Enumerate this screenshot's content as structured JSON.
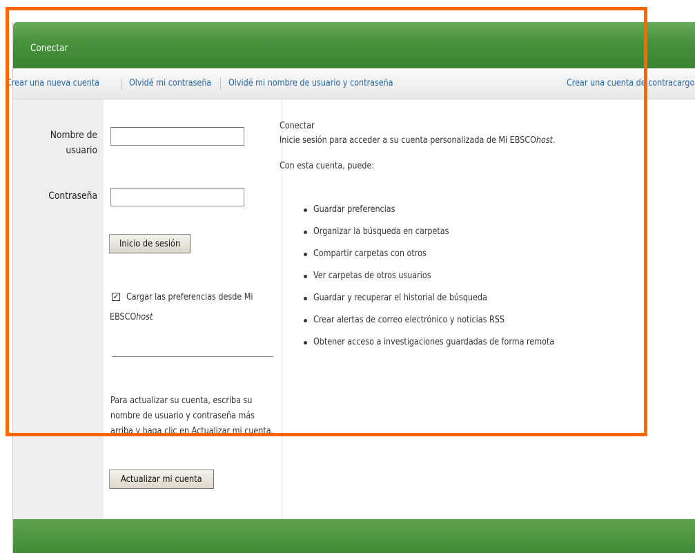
{
  "header": {
    "title": "Conectar"
  },
  "nav": {
    "links": [
      "Crear una nueva cuenta",
      "Olvidé mi contraseña",
      "Olvidé mi nombre de usuario y contraseña",
      "Crear una cuenta de contracargo"
    ]
  },
  "login": {
    "username_label_line1": "Nombre de",
    "username_label_line2": "usuario",
    "username_value": "",
    "password_label": "Contraseña",
    "password_value": "",
    "signin_button": "Inicio de sesión",
    "checkbox_checked": true,
    "checkbox_label_line1": "Cargar las preferencias desde Mi",
    "checkbox_label_line2_prefix": "EBSCO",
    "checkbox_label_line2_italic": "host"
  },
  "update": {
    "text_line1": "Para actualizar su cuenta, escriba su",
    "text_line2": "nombre de usuario y contraseña más",
    "text_line3": "arriba y haga clic en Actualizar mi cuenta.",
    "button": "Actualizar mi cuenta"
  },
  "info": {
    "heading": "Conectar",
    "intro_prefix": "Inicie sesión para acceder a su cuenta personalizada de Mi EBSCO",
    "intro_italic": "host",
    "intro_suffix": ".",
    "subheading": "Con esta cuenta, puede:",
    "features": [
      "Guardar preferencias",
      "Organizar la búsqueda en carpetas",
      "Compartir carpetas con otros",
      "Ver carpetas de otros usuarios",
      "Guardar y recuperar el historial de búsqueda",
      "Crear alertas de correo electrónico y noticias RSS",
      "Obtener acceso a investigaciones guardadas de forma remota"
    ]
  },
  "colors": {
    "header_green": "#47913b",
    "link_blue": "#2266aa",
    "highlight_orange": "#ff6600"
  }
}
